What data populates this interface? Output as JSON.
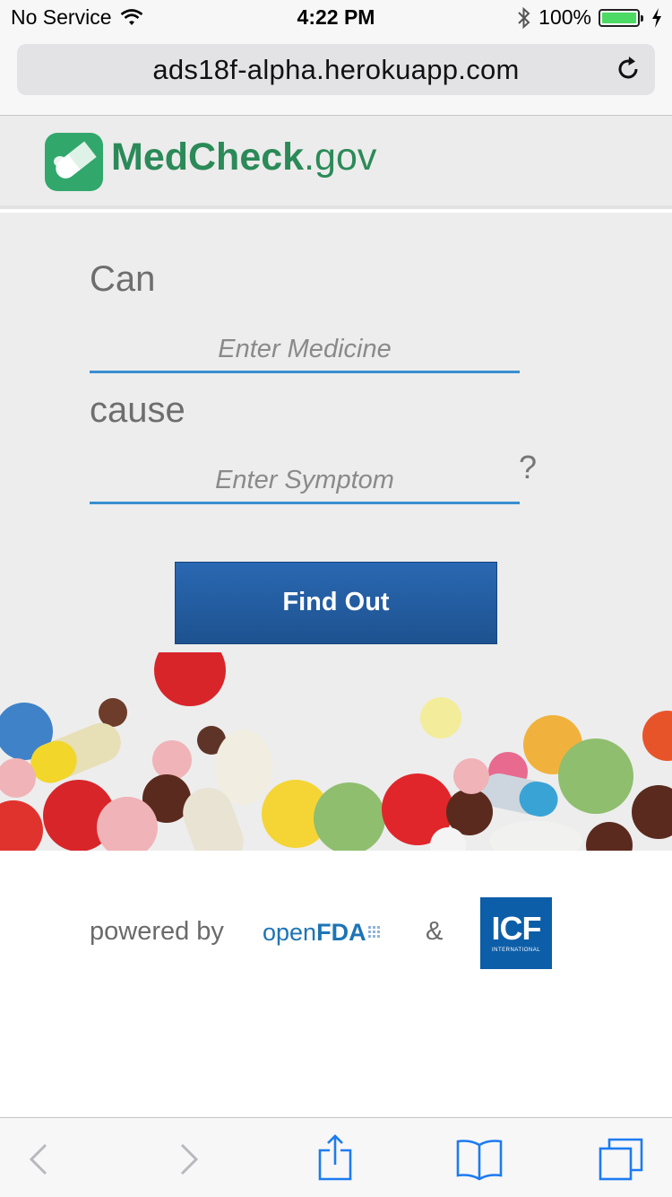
{
  "status_bar": {
    "carrier": "No Service",
    "time": "4:22 PM",
    "battery": "100%",
    "battery_level": 1.0,
    "icons": [
      "wifi-icon",
      "bluetooth-icon",
      "battery-icon",
      "charging-icon"
    ]
  },
  "browser": {
    "url": "ads18f-alpha.herokuapp.com",
    "reload_icon": "reload-icon"
  },
  "header": {
    "logo_bold": "MedCheck",
    "logo_suffix": ".gov",
    "logo_icon": "pill-icon",
    "brand_color": "#2b8a58"
  },
  "form": {
    "label_can": "Can",
    "medicine_placeholder": "Enter Medicine",
    "label_cause": "cause",
    "symptom_placeholder": "Enter Symptom",
    "question_mark": "?",
    "button_label": "Find Out",
    "accent_color": "#3a8fd1",
    "button_color": "#2a68b2"
  },
  "footer": {
    "powered_by": "powered by",
    "openfda_light": "open",
    "openfda_bold": "FDA",
    "ampersand": "&",
    "icf_logo": "ICF",
    "icf_subtext": "INTERNATIONAL"
  },
  "toolbar": {
    "icons": [
      "back-icon",
      "forward-icon",
      "share-icon",
      "bookmarks-icon",
      "tabs-icon"
    ]
  }
}
